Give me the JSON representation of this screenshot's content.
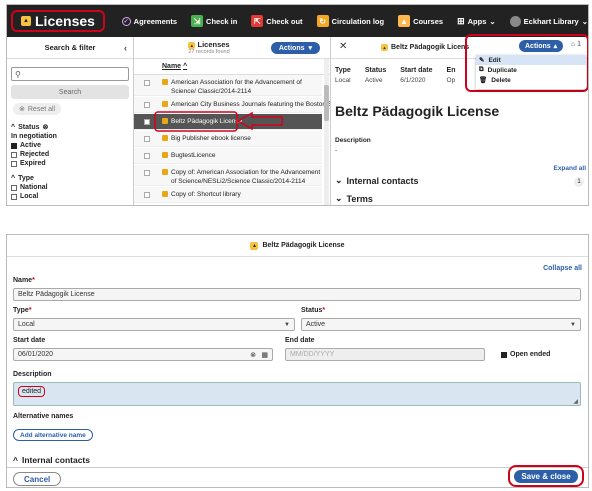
{
  "topbar": {
    "app_title": "Licenses",
    "nav": [
      {
        "label": "Agreements",
        "icon": "agreements-icon",
        "color": "#d6a3f5"
      },
      {
        "label": "Check in",
        "icon": "check-in-icon",
        "color": "#4caf50"
      },
      {
        "label": "Check out",
        "icon": "check-out-icon",
        "color": "#e53935"
      },
      {
        "label": "Circulation log",
        "icon": "circulation-log-icon",
        "color": "#f5a623"
      },
      {
        "label": "Courses",
        "icon": "courses-icon",
        "color": "#ffb74d"
      },
      {
        "label": "Apps",
        "icon": "apps-grid-icon",
        "color": "#ffffff"
      },
      {
        "label": "Eckhart Library",
        "icon": "user-avatar-icon",
        "color": "#ffffff"
      }
    ]
  },
  "filters": {
    "title": "Search & filter",
    "search_button": "Search",
    "reset_button": "Reset all",
    "status_heading": "Status",
    "status_options": [
      {
        "label": "In negotiation",
        "checked": false,
        "plain": true
      },
      {
        "label": "Active",
        "checked": true
      },
      {
        "label": "Rejected",
        "checked": false
      },
      {
        "label": "Expired",
        "checked": false
      }
    ],
    "type_heading": "Type",
    "type_options": [
      {
        "label": "National",
        "checked": false
      },
      {
        "label": "Local",
        "checked": false
      }
    ]
  },
  "results": {
    "title": "Licenses",
    "count": "27 records found",
    "actions_label": "Actions",
    "column_name": "Name",
    "rows": [
      {
        "name": "American Association for the Advancement of Science/ Classic/2014-2114",
        "selected": false
      },
      {
        "name": "American City Business Journals featuring the Boston B",
        "selected": false
      },
      {
        "name": "Beltz Pädagogik License",
        "selected": true
      },
      {
        "name": "Big Publisher ebook license",
        "selected": false
      },
      {
        "name": "BugtestLicence",
        "selected": false
      },
      {
        "name": "Copy of: American Association for the Advancement of Science/NESLi2/Science Classic/2014-2114",
        "selected": false
      },
      {
        "name": "Copy of: Shortcut library",
        "selected": false
      }
    ]
  },
  "detail": {
    "title": "Beltz Pädagogik License",
    "title_short": "Beltz Pädagogik Licens",
    "actions_label": "Actions",
    "tag_count": "1",
    "menu": [
      {
        "label": "Edit",
        "icon": "pencil-icon"
      },
      {
        "label": "Duplicate",
        "icon": "duplicate-icon"
      },
      {
        "label": "Delete",
        "icon": "trash-icon"
      }
    ],
    "meta": [
      {
        "key": "Type",
        "value": "Local"
      },
      {
        "key": "Status",
        "value": "Active"
      },
      {
        "key": "Start date",
        "value": "6/1/2020"
      },
      {
        "key": "En",
        "value": "Op"
      }
    ],
    "description_label": "Description",
    "description_value": "-",
    "expand_all": "Expand all",
    "internal_contacts": "Internal contacts",
    "internal_contacts_count": "1",
    "terms": "Terms"
  },
  "edit_form": {
    "title": "Beltz Pädagogik License",
    "collapse_all": "Collapse all",
    "name_label": "Name",
    "name_value": "Beltz Pädagogik License",
    "type_label": "Type",
    "type_value": "Local",
    "status_label": "Status",
    "status_value": "Active",
    "start_date_label": "Start date",
    "start_date_value": "06/01/2020",
    "end_date_label": "End date",
    "end_date_placeholder": "MM/DD/YYYY",
    "open_ended_label": "Open ended",
    "description_label": "Description",
    "description_value": "edited",
    "alt_names_label": "Alternative names",
    "add_alt_button": "Add alternative name",
    "internal_contacts": "Internal contacts",
    "cancel_button": "Cancel",
    "save_button": "Save & close"
  },
  "colors": {
    "topbar": "#222222",
    "accent": "#2d5fa8",
    "annotation": "#d0021b",
    "selected_row": "#555555"
  }
}
